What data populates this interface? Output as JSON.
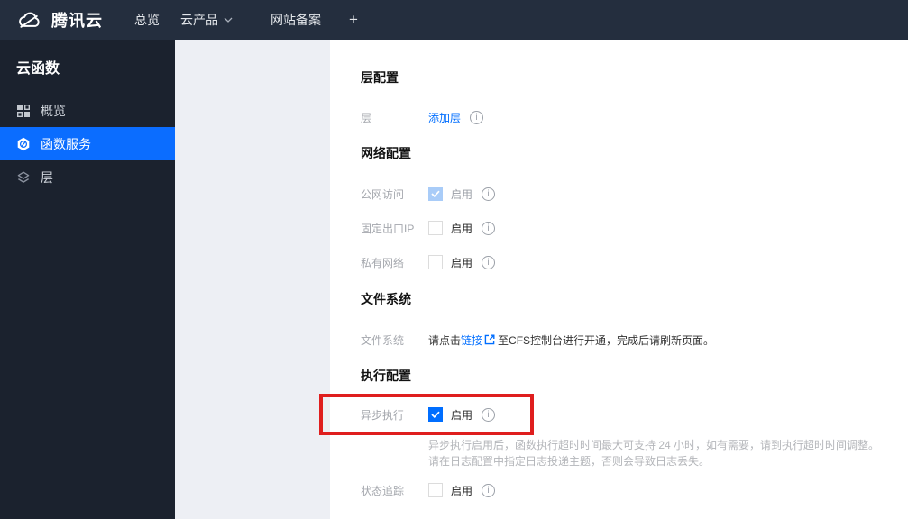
{
  "topnav": {
    "brand": "腾讯云",
    "items": [
      {
        "label": "总览"
      },
      {
        "label": "云产品"
      },
      {
        "label": "网站备案"
      },
      {
        "label": "+"
      }
    ]
  },
  "sidebar": {
    "title": "云函数",
    "items": [
      {
        "label": "概览",
        "icon": "overview-grid-icon",
        "active": false
      },
      {
        "label": "函数服务",
        "icon": "function-service-hexagon-icon",
        "active": true
      },
      {
        "label": "层",
        "icon": "layers-icon",
        "active": false
      }
    ]
  },
  "content": {
    "layer_section": {
      "heading": "层配置",
      "row": {
        "label": "层",
        "link": "添加层"
      }
    },
    "network_section": {
      "heading": "网络配置",
      "rows": [
        {
          "label": "公网访问",
          "value": "启用",
          "checkbox": "checked-disabled"
        },
        {
          "label": "固定出口IP",
          "value": "启用",
          "checkbox": "unchecked"
        },
        {
          "label": "私有网络",
          "value": "启用",
          "checkbox": "unchecked"
        }
      ]
    },
    "filesystem_section": {
      "heading": "文件系统",
      "row": {
        "label": "文件系统",
        "text_before_link": "请点击",
        "link": "链接",
        "text_after_link": "至CFS控制台进行开通，完成后请刷新页面。"
      }
    },
    "execution_section": {
      "heading": "执行配置",
      "async_row": {
        "label": "异步执行",
        "value": "启用",
        "checkbox": "checked"
      },
      "helper_line1": "异步执行启用后，函数执行超时时间最大可支持 24 小时，如有需要，请到执行超时时间调整。",
      "helper_line2": "请在日志配置中指定日志投递主题，否则会导致日志丢失。",
      "status_row": {
        "label": "状态追踪",
        "value": "启用",
        "checkbox": "unchecked"
      }
    }
  },
  "icons": {
    "info": "i"
  },
  "colors": {
    "accent_blue": "#006eff",
    "navbar_bg": "#242e3e",
    "sidebar_bg": "#1b222e",
    "active_item_bg": "#0b6dff",
    "page_bg": "#edeff4",
    "annotation_red": "#df1e1e",
    "checked_disabled_blue": "#a9ccf8"
  }
}
